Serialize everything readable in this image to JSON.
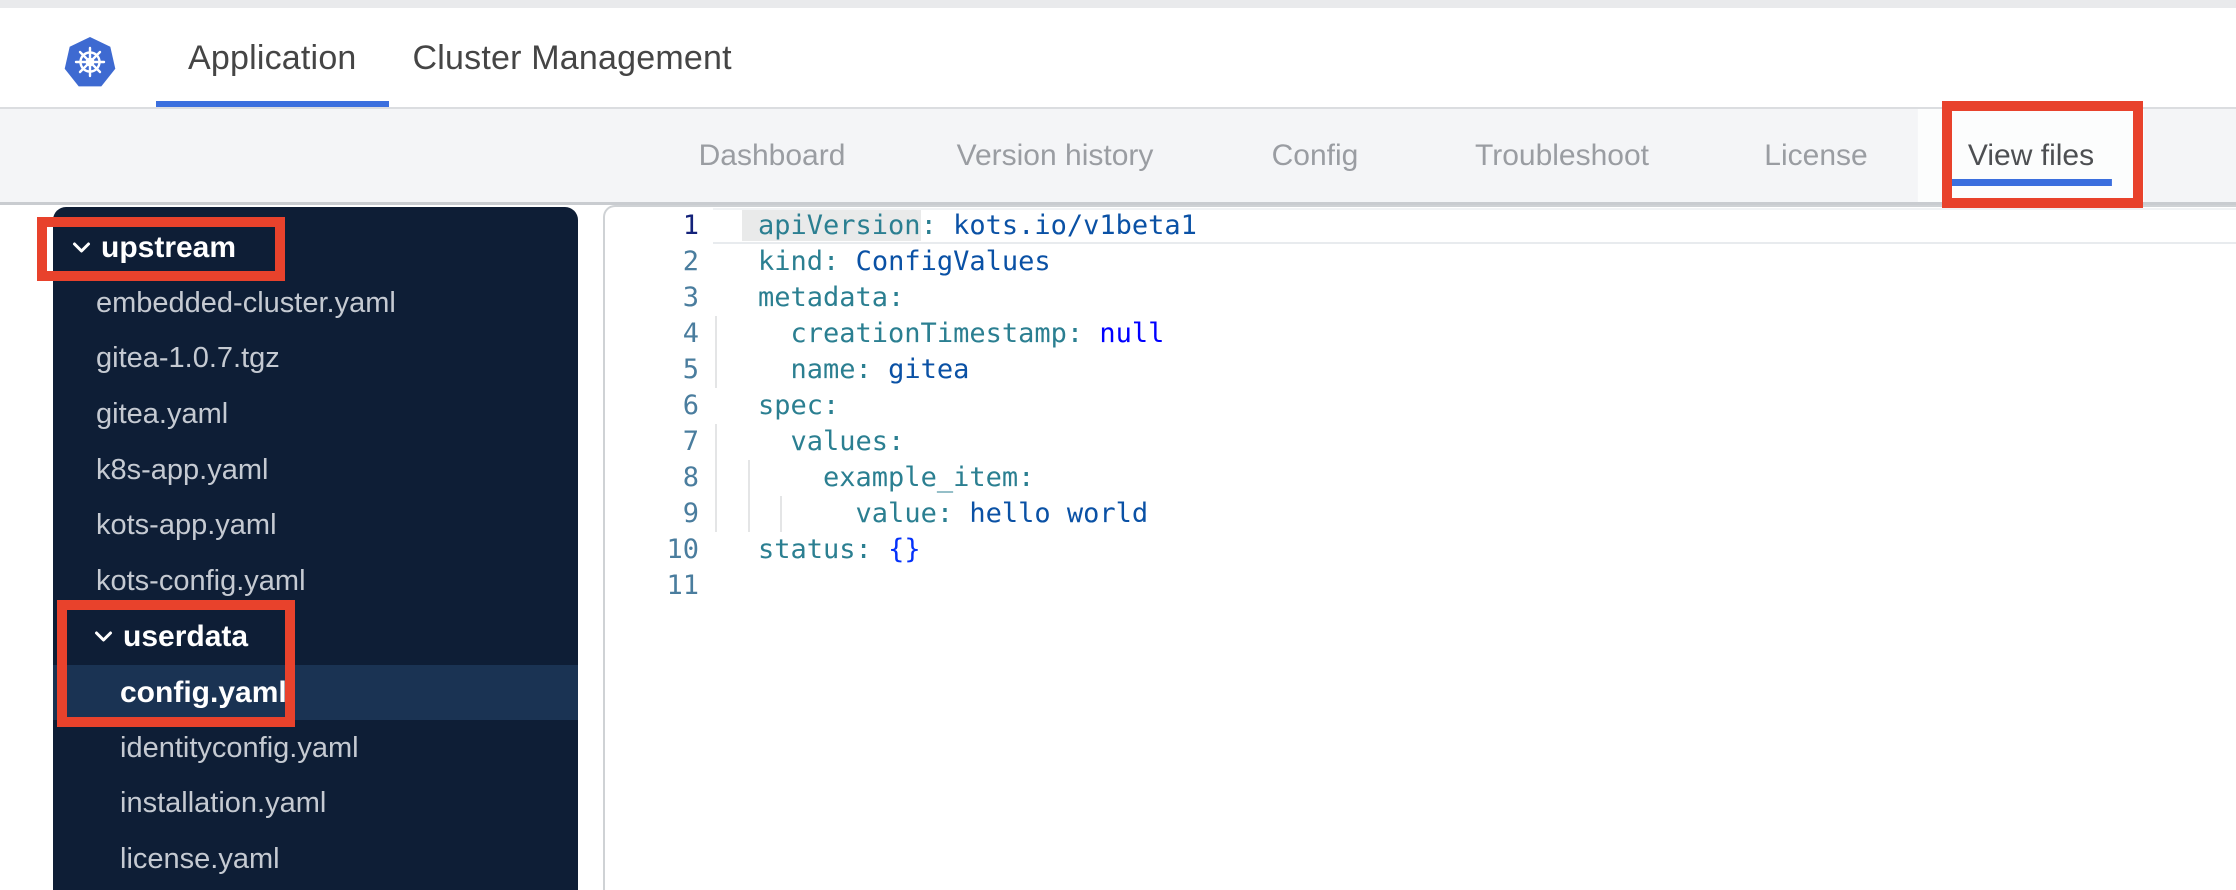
{
  "header": {
    "logo": "kubernetes-logo",
    "tabs": [
      {
        "label": "Application",
        "active": true
      },
      {
        "label": "Cluster Management",
        "active": false
      }
    ]
  },
  "subnav": {
    "tabs": [
      {
        "label": "Dashboard",
        "active": false
      },
      {
        "label": "Version history",
        "active": false
      },
      {
        "label": "Config",
        "active": false
      },
      {
        "label": "Troubleshoot",
        "active": false
      },
      {
        "label": "License",
        "active": false
      },
      {
        "label": "View files",
        "active": true
      }
    ]
  },
  "file_tree": {
    "items": [
      {
        "label": "upstream",
        "type": "folder",
        "level": 0,
        "expanded": true
      },
      {
        "label": "embedded-cluster.yaml",
        "type": "file",
        "level": 1
      },
      {
        "label": "gitea-1.0.7.tgz",
        "type": "file",
        "level": 1
      },
      {
        "label": "gitea.yaml",
        "type": "file",
        "level": 1
      },
      {
        "label": "k8s-app.yaml",
        "type": "file",
        "level": 1
      },
      {
        "label": "kots-app.yaml",
        "type": "file",
        "level": 1
      },
      {
        "label": "kots-config.yaml",
        "type": "file",
        "level": 1
      },
      {
        "label": "userdata",
        "type": "folder",
        "level": 1,
        "expanded": true
      },
      {
        "label": "config.yaml",
        "type": "file",
        "level": 2,
        "selected": true
      },
      {
        "label": "identityconfig.yaml",
        "type": "file",
        "level": 2
      },
      {
        "label": "installation.yaml",
        "type": "file",
        "level": 2
      },
      {
        "label": "license.yaml",
        "type": "file",
        "level": 2
      }
    ]
  },
  "editor": {
    "language": "yaml",
    "lines": [
      {
        "num": 1,
        "current": true,
        "guides": 0,
        "tokens": [
          {
            "type": "key",
            "text": "apiVersion",
            "highlight": true
          },
          {
            "type": "punc",
            "text": ":"
          },
          {
            "type": "plain",
            "text": " "
          },
          {
            "type": "string",
            "text": "kots.io/v1beta1"
          }
        ]
      },
      {
        "num": 2,
        "guides": 0,
        "tokens": [
          {
            "type": "key",
            "text": "kind"
          },
          {
            "type": "punc",
            "text": ":"
          },
          {
            "type": "plain",
            "text": " "
          },
          {
            "type": "string",
            "text": "ConfigValues"
          }
        ]
      },
      {
        "num": 3,
        "guides": 0,
        "tokens": [
          {
            "type": "key",
            "text": "metadata"
          },
          {
            "type": "punc",
            "text": ":"
          }
        ]
      },
      {
        "num": 4,
        "guides": 1,
        "tokens": [
          {
            "type": "plain",
            "text": "  "
          },
          {
            "type": "key",
            "text": "creationTimestamp"
          },
          {
            "type": "punc",
            "text": ":"
          },
          {
            "type": "plain",
            "text": " "
          },
          {
            "type": "keyword",
            "text": "null"
          }
        ]
      },
      {
        "num": 5,
        "guides": 1,
        "tokens": [
          {
            "type": "plain",
            "text": "  "
          },
          {
            "type": "key",
            "text": "name"
          },
          {
            "type": "punc",
            "text": ":"
          },
          {
            "type": "plain",
            "text": " "
          },
          {
            "type": "string",
            "text": "gitea"
          }
        ]
      },
      {
        "num": 6,
        "guides": 0,
        "tokens": [
          {
            "type": "key",
            "text": "spec"
          },
          {
            "type": "punc",
            "text": ":"
          }
        ]
      },
      {
        "num": 7,
        "guides": 1,
        "tokens": [
          {
            "type": "plain",
            "text": "  "
          },
          {
            "type": "key",
            "text": "values"
          },
          {
            "type": "punc",
            "text": ":"
          }
        ]
      },
      {
        "num": 8,
        "guides": 2,
        "tokens": [
          {
            "type": "plain",
            "text": "    "
          },
          {
            "type": "key",
            "text": "example_item"
          },
          {
            "type": "punc",
            "text": ":"
          }
        ]
      },
      {
        "num": 9,
        "guides": 3,
        "tokens": [
          {
            "type": "plain",
            "text": "      "
          },
          {
            "type": "key",
            "text": "value"
          },
          {
            "type": "punc",
            "text": ":"
          },
          {
            "type": "plain",
            "text": " "
          },
          {
            "type": "string",
            "text": "hello world"
          }
        ]
      },
      {
        "num": 10,
        "guides": 0,
        "tokens": [
          {
            "type": "key",
            "text": "status"
          },
          {
            "type": "punc",
            "text": ":"
          },
          {
            "type": "plain",
            "text": " "
          },
          {
            "type": "bracket",
            "text": "{}"
          }
        ]
      },
      {
        "num": 11,
        "guides": 0,
        "tokens": []
      }
    ]
  },
  "annotations": {
    "color": "#e8422c",
    "boxes": [
      "upstream-folder",
      "userdata-config-yaml",
      "view-files-tab"
    ]
  },
  "colors": {
    "accent_blue": "#3b6fde",
    "logo_blue": "#3e6ad1",
    "sidebar_bg": "#0e1e36",
    "sidebar_selected": "#1a3353",
    "annotation_red": "#e8422c",
    "syntax": {
      "key": "#2b7f91",
      "string": "#0a51a5",
      "keyword": "#0000ff",
      "bracket": "#0431fa",
      "line_number": "#4a7d9e"
    }
  }
}
